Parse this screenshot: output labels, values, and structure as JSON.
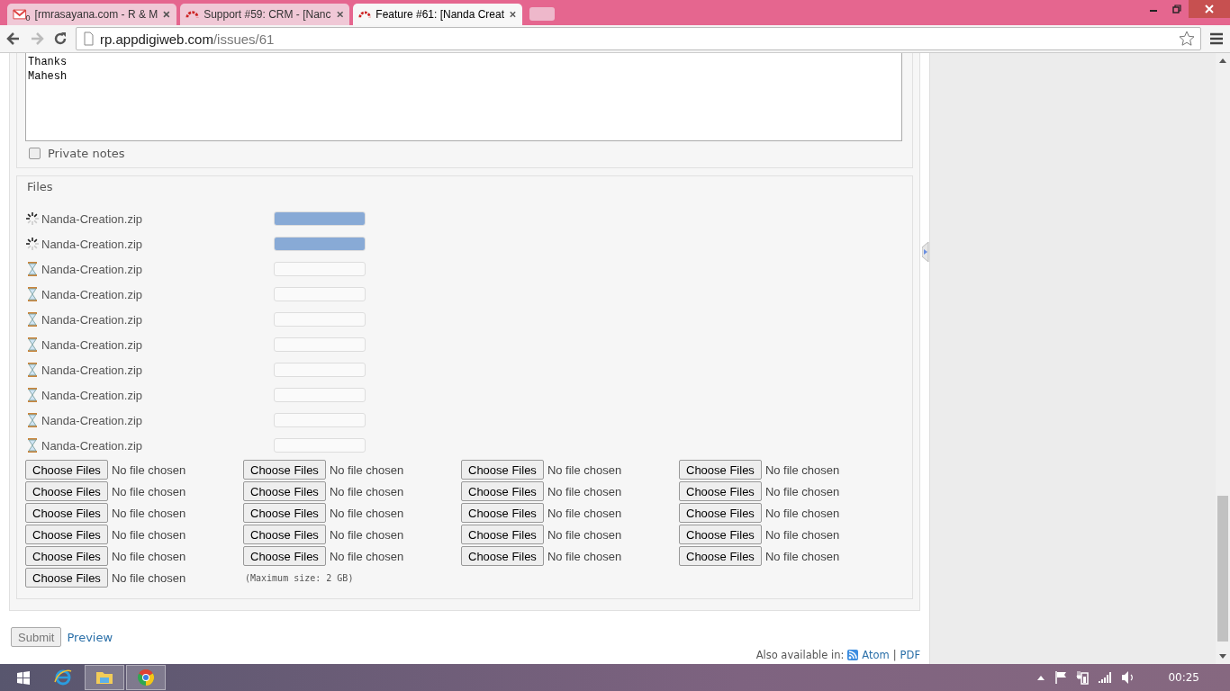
{
  "browser": {
    "tabs": [
      {
        "title": "[rmrasayana.com - R & M",
        "kind": "mail",
        "badge": "0",
        "selected": false
      },
      {
        "title": "Support #59: CRM - [Nanc",
        "kind": "issue",
        "selected": false
      },
      {
        "title": "Feature #61: [Nanda Creat",
        "kind": "issue",
        "selected": true
      }
    ],
    "address": {
      "host": "rp.appdigiweb.com",
      "path": "/issues/61"
    }
  },
  "notes": {
    "value": "Thanks\nMahesh",
    "private_notes": {
      "label": "Private notes",
      "checked": false
    }
  },
  "files": {
    "legend": "Files",
    "uploads": [
      {
        "name": "Nanda-Creation.zip",
        "kind": "uploading",
        "level": 1
      },
      {
        "name": "Nanda-Creation.zip",
        "kind": "uploading",
        "level": 1
      },
      {
        "name": "Nanda-Creation.zip",
        "kind": "waiting",
        "level": 0
      },
      {
        "name": "Nanda-Creation.zip",
        "kind": "waiting",
        "level": 0
      },
      {
        "name": "Nanda-Creation.zip",
        "kind": "waiting",
        "level": 0
      },
      {
        "name": "Nanda-Creation.zip",
        "kind": "waiting",
        "level": 0
      },
      {
        "name": "Nanda-Creation.zip",
        "kind": "waiting",
        "level": 0
      },
      {
        "name": "Nanda-Creation.zip",
        "kind": "waiting",
        "level": 0
      },
      {
        "name": "Nanda-Creation.zip",
        "kind": "waiting",
        "level": 0
      },
      {
        "name": "Nanda-Creation.zip",
        "kind": "waiting",
        "level": 0
      }
    ],
    "inputs_count_note": "(Maximum size: 2 GB)",
    "inputs": [
      {
        "button": "Choose Files",
        "status": "No file chosen"
      },
      {
        "button": "Choose Files",
        "status": "No file chosen"
      },
      {
        "button": "Choose Files",
        "status": "No file chosen"
      },
      {
        "button": "Choose Files",
        "status": "No file chosen"
      },
      {
        "button": "Choose Files",
        "status": "No file chosen"
      },
      {
        "button": "Choose Files",
        "status": "No file chosen"
      },
      {
        "button": "Choose Files",
        "status": "No file chosen"
      },
      {
        "button": "Choose Files",
        "status": "No file chosen"
      },
      {
        "button": "Choose Files",
        "status": "No file chosen"
      },
      {
        "button": "Choose Files",
        "status": "No file chosen"
      },
      {
        "button": "Choose Files",
        "status": "No file chosen"
      },
      {
        "button": "Choose Files",
        "status": "No file chosen"
      },
      {
        "button": "Choose Files",
        "status": "No file chosen"
      },
      {
        "button": "Choose Files",
        "status": "No file chosen"
      },
      {
        "button": "Choose Files",
        "status": "No file chosen"
      },
      {
        "button": "Choose Files",
        "status": "No file chosen"
      },
      {
        "button": "Choose Files",
        "status": "No file chosen"
      },
      {
        "button": "Choose Files",
        "status": "No file chosen"
      },
      {
        "button": "Choose Files",
        "status": "No file chosen"
      },
      {
        "button": "Choose Files",
        "status": "No file chosen"
      },
      {
        "button": "Choose Files",
        "status": "No file chosen"
      }
    ]
  },
  "actions": {
    "submit": "Submit",
    "preview": "Preview"
  },
  "footer": {
    "label": "Also available in:",
    "links": [
      "Atom",
      "PDF"
    ],
    "separator": "|"
  },
  "taskbar": {
    "clock": "00:25"
  }
}
